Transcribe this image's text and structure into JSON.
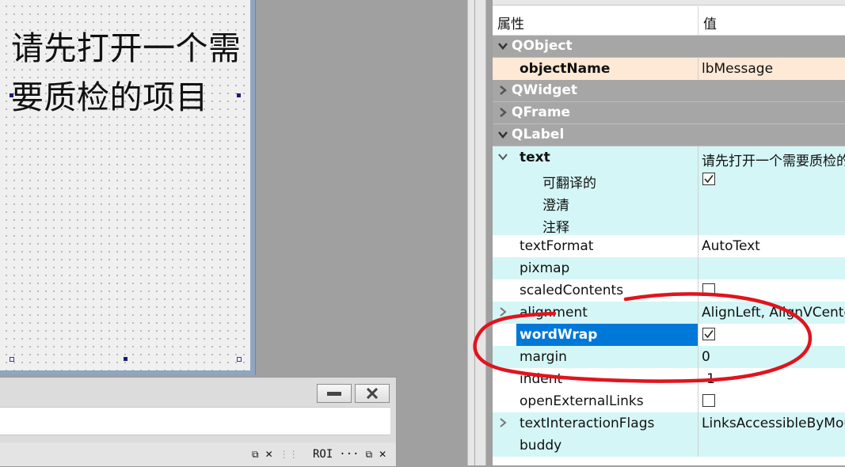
{
  "form": {
    "label_text": "请先打开一个需要质检的项目"
  },
  "dock": {
    "minimize_label": "—",
    "close_label": "✕",
    "tab1_pin": "⧉",
    "tab1_close": "✕",
    "tab2_dots": "⋮⋮",
    "roi_label": "ROI",
    "roi_more": "···",
    "roi_pin": "⧉",
    "roi_close": "✕"
  },
  "properties": {
    "header_property": "属性",
    "header_value": "值",
    "rows": [
      {
        "kind": "group",
        "name": "QObject",
        "expanded": true
      },
      {
        "kind": "prop",
        "name": "objectName",
        "value": "lbMessage",
        "bold": true,
        "bg": "peach",
        "indent": 1
      },
      {
        "kind": "group",
        "name": "QWidget",
        "expanded": false
      },
      {
        "kind": "group",
        "name": "QFrame",
        "expanded": false
      },
      {
        "kind": "group",
        "name": "QLabel",
        "expanded": true
      },
      {
        "kind": "prop",
        "name": "text",
        "value": "请先打开一个需要质检的项目",
        "bold": true,
        "bg": "cyan",
        "indent": 1,
        "expander": "open"
      },
      {
        "kind": "prop",
        "name": "可翻译的",
        "value": "",
        "checked": true,
        "bg": "cyan",
        "indent": 2
      },
      {
        "kind": "prop",
        "name": "澄清",
        "value": "",
        "bg": "cyan",
        "indent": 2
      },
      {
        "kind": "prop",
        "name": "注释",
        "value": "",
        "bg": "cyan",
        "indent": 2
      },
      {
        "kind": "prop",
        "name": "textFormat",
        "value": "AutoText",
        "bg": "white",
        "indent": 1
      },
      {
        "kind": "prop",
        "name": "pixmap",
        "value": "",
        "bg": "cyan",
        "indent": 1
      },
      {
        "kind": "prop",
        "name": "scaledContents",
        "value": "",
        "checked": false,
        "bg": "white",
        "indent": 1
      },
      {
        "kind": "prop",
        "name": "alignment",
        "value": "AlignLeft, AlignVCenter",
        "bg": "cyan",
        "indent": 1,
        "expander": "closed"
      },
      {
        "kind": "prop",
        "name": "wordWrap",
        "value": "",
        "checked": true,
        "bg": "white",
        "indent": 1,
        "selected": true
      },
      {
        "kind": "prop",
        "name": "margin",
        "value": "0",
        "bg": "cyan",
        "indent": 1
      },
      {
        "kind": "prop",
        "name": "indent",
        "value": "-1",
        "bg": "white",
        "indent": 1
      },
      {
        "kind": "prop",
        "name": "openExternalLinks",
        "value": "",
        "checked": false,
        "bg": "white",
        "indent": 1
      },
      {
        "kind": "prop",
        "name": "textInteractionFlags",
        "value": "LinksAccessibleByMouse",
        "bg": "cyan",
        "indent": 1,
        "expander": "closed"
      },
      {
        "kind": "prop",
        "name": "buddy",
        "value": "",
        "bg": "cyan",
        "indent": 1
      }
    ]
  },
  "colors": {
    "group_bg": "#a6a6a6",
    "cyan_bg": "#d4f6f6",
    "selection": "#0078d7",
    "annotation": "#e0141e"
  }
}
